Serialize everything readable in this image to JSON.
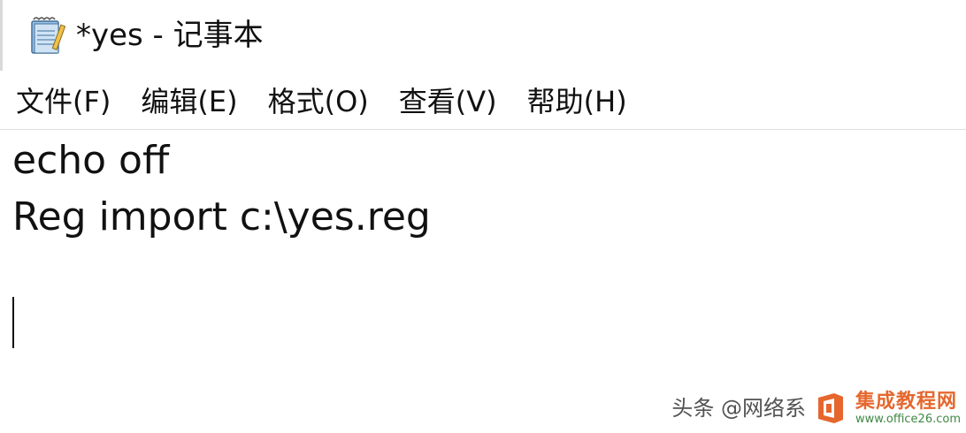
{
  "window": {
    "title": "*yes - 记事本",
    "app_icon": "notepad-icon"
  },
  "menu": {
    "items": [
      {
        "label": "文件(F)"
      },
      {
        "label": "编辑(E)"
      },
      {
        "label": "格式(O)"
      },
      {
        "label": "查看(V)"
      },
      {
        "label": "帮助(H)"
      }
    ]
  },
  "editor": {
    "lines": [
      "echo off",
      "Reg import c:\\yes.reg"
    ]
  },
  "watermark": {
    "text": "头条 @网络系",
    "brand_main": "集成教程网",
    "brand_sub": "www.office26.com",
    "logo_icon": "office-logo-icon",
    "brand_color": "#e35b1c"
  }
}
